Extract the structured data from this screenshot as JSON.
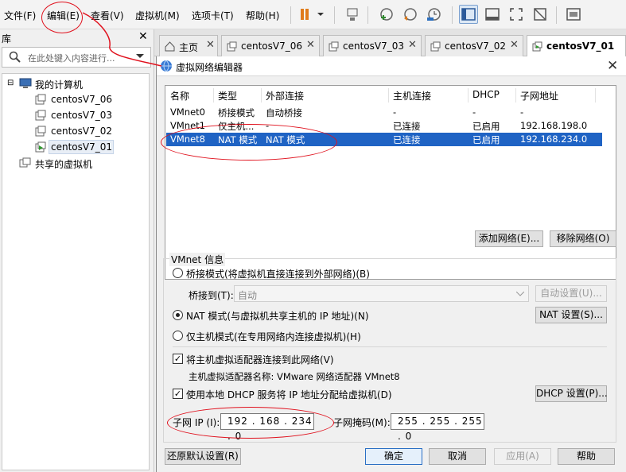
{
  "menubar": {
    "items": [
      "文件(F)",
      "编辑(E)",
      "查看(V)",
      "虚拟机(M)",
      "选项卡(T)",
      "帮助(H)"
    ]
  },
  "toolbar": {
    "icons": [
      "pause-icon",
      "dropdown-icon",
      "send-ctrl-alt-del-icon",
      "snapshot-take-icon",
      "snapshot-revert-icon",
      "snapshot-manager-icon",
      "library-view-icon",
      "console-view-icon",
      "fullscreen-icon",
      "unity-icon",
      "thumbnail-icon"
    ]
  },
  "library": {
    "title": "库",
    "search_placeholder": "在此处键入内容进行...",
    "tree": {
      "root": "我的计算机",
      "vms": [
        "centosV7_06",
        "centosV7_03",
        "centosV7_02",
        "centosV7_01"
      ],
      "shared": "共享的虚拟机"
    }
  },
  "tabs": [
    {
      "label": "主页"
    },
    {
      "label": "centosV7_06"
    },
    {
      "label": "centosV7_03"
    },
    {
      "label": "centosV7_02"
    },
    {
      "label": "centosV7_01"
    }
  ],
  "dialog": {
    "title": "虚拟网络编辑器",
    "columns": [
      "名称",
      "类型",
      "外部连接",
      "主机连接",
      "DHCP",
      "子网地址"
    ],
    "networks": [
      {
        "name": "VMnet0",
        "type": "桥接模式",
        "external": "自动桥接",
        "host": "-",
        "dhcp": "-",
        "subnet": "-"
      },
      {
        "name": "VMnet1",
        "type": "仅主机...",
        "external": "-",
        "host": "已连接",
        "dhcp": "已启用",
        "subnet": "192.168.198.0"
      },
      {
        "name": "VMnet8",
        "type": "NAT 模式",
        "external": "NAT 模式",
        "host": "已连接",
        "dhcp": "已启用",
        "subnet": "192.168.234.0"
      }
    ],
    "add_network": "添加网络(E)...",
    "remove_network": "移除网络(O)",
    "group_label": "VMnet 信息",
    "bridge_mode": "桥接模式(将虚拟机直接连接到外部网络)(B)",
    "bridge_to_label": "桥接到(T):",
    "bridge_to_value": "自动",
    "auto_settings": "自动设置(U)...",
    "nat_mode": "NAT 模式(与虚拟机共享主机的 IP 地址)(N)",
    "nat_settings": "NAT 设置(S)...",
    "host_only_mode": "仅主机模式(在专用网络内连接虚拟机)(H)",
    "connect_adapter": "将主机虚拟适配器连接到此网络(V)",
    "adapter_name": "主机虚拟适配器名称: VMware 网络适配器 VMnet8",
    "use_dhcp": "使用本地 DHCP 服务将 IP 地址分配给虚拟机(D)",
    "dhcp_settings": "DHCP 设置(P)...",
    "subnet_ip_label": "子网 IP (I):",
    "subnet_ip": "192 . 168 . 234 . 0",
    "subnet_mask_label": "子网掩码(M):",
    "subnet_mask": "255 . 255 . 255 . 0",
    "restore_defaults": "还原默认设置(R)",
    "ok": "确定",
    "cancel": "取消",
    "apply": "应用(A)",
    "help": "帮助"
  }
}
